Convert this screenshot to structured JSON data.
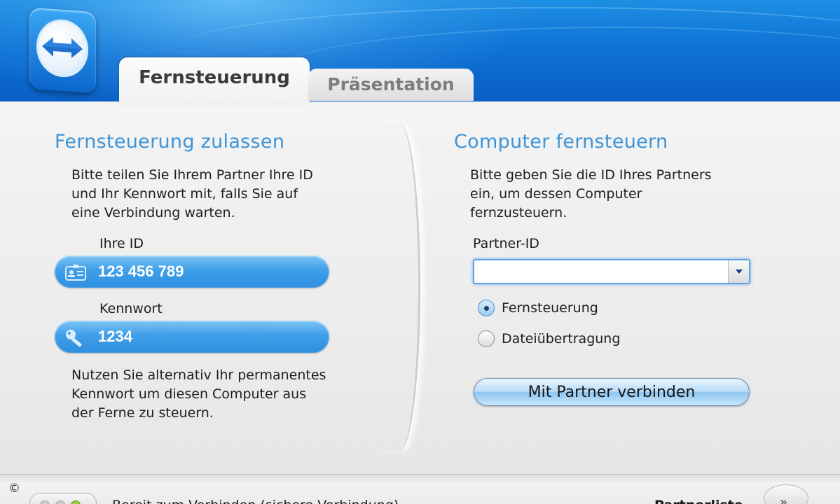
{
  "tabs": {
    "active": "Fernsteuerung",
    "inactive": "Präsentation"
  },
  "left": {
    "title": "Fernsteuerung zulassen",
    "intro_lines": [
      "Bitte teilen Sie Ihrem Partner Ihre ID",
      "und Ihr Kennwort mit, falls Sie auf",
      "eine Verbindung warten."
    ],
    "id_label": "Ihre ID",
    "id_value": "123 456 789",
    "password_label": "Kennwort",
    "password_value": "1234",
    "footer_lines": [
      "Nutzen Sie alternativ Ihr permanentes",
      "Kennwort um diesen Computer aus",
      "der Ferne zu steuern."
    ]
  },
  "right": {
    "title": "Computer fernsteuern",
    "intro_lines": [
      "Bitte geben Sie die ID Ihres Partners",
      "ein, um dessen Computer",
      "fernzusteuern."
    ],
    "partner_id_label": "Partner-ID",
    "partner_id_value": "",
    "radio_options": [
      "Fernsteuerung",
      "Dateiübertragung"
    ],
    "selected_option": "Fernsteuerung",
    "connect_button": "Mit Partner verbinden"
  },
  "statusbar": {
    "copyright": "©",
    "status_text": "Bereit zum Verbinden (sichere Verbindung)",
    "partner_list": "Partnerliste",
    "toggle_glyph": "»"
  },
  "colors": {
    "header_blue": "#0f73d6",
    "title_blue": "#3c93d6",
    "pill_blue": "#3f9fe8",
    "status_led_green": "#9ccf3c"
  },
  "icons": {
    "logo": "teamviewer-arrows-logo",
    "id_field": "id-card-icon",
    "password_field": "key-icon",
    "combo": "dropdown-arrow-icon"
  }
}
